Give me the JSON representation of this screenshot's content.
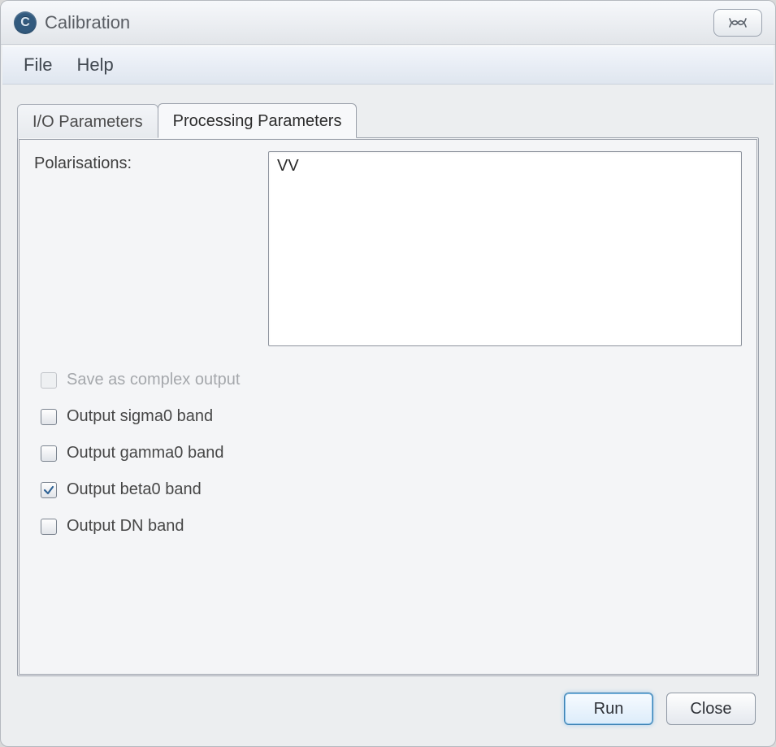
{
  "window": {
    "title": "Calibration",
    "icon_glyph": "C",
    "close_icon": "close"
  },
  "menubar": {
    "items": [
      {
        "label": "File"
      },
      {
        "label": "Help"
      }
    ]
  },
  "tabs": {
    "items": [
      {
        "label": "I/O Parameters",
        "active": false
      },
      {
        "label": "Processing Parameters",
        "active": true
      }
    ]
  },
  "panel": {
    "polarisations_label": "Polarisations:",
    "polarisations_items": [
      {
        "text": "VV"
      }
    ],
    "checks": [
      {
        "key": "save_complex",
        "label": "Save as complex output",
        "checked": false,
        "disabled": true
      },
      {
        "key": "output_sigma0",
        "label": "Output sigma0 band",
        "checked": false,
        "disabled": false
      },
      {
        "key": "output_gamma0",
        "label": "Output gamma0 band",
        "checked": false,
        "disabled": false
      },
      {
        "key": "output_beta0",
        "label": "Output beta0 band",
        "checked": true,
        "disabled": false
      },
      {
        "key": "output_dn",
        "label": "Output DN band",
        "checked": false,
        "disabled": false
      }
    ]
  },
  "buttons": {
    "run": "Run",
    "close": "Close"
  }
}
